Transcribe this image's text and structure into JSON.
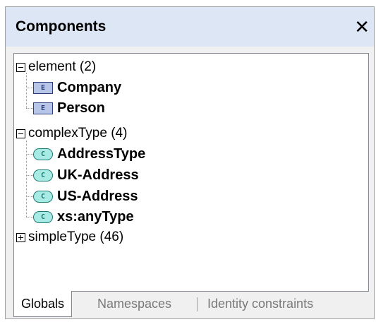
{
  "panel": {
    "title": "Components",
    "close_glyph": "✕"
  },
  "tree": {
    "groups": [
      {
        "label": "element (2)",
        "expanded": true,
        "icon": "collapse-icon",
        "children": [
          {
            "badge": "E",
            "label": "Company",
            "icon": "element-icon"
          },
          {
            "badge": "E",
            "label": "Person",
            "icon": "element-icon"
          }
        ]
      },
      {
        "label": "complexType (4)",
        "expanded": true,
        "icon": "collapse-icon",
        "children": [
          {
            "badge": "C",
            "label": "AddressType",
            "icon": "complex-type-icon"
          },
          {
            "badge": "C",
            "label": "UK-Address",
            "icon": "complex-type-icon"
          },
          {
            "badge": "C",
            "label": "US-Address",
            "icon": "complex-type-icon"
          },
          {
            "badge": "C",
            "label": "xs:anyType",
            "icon": "complex-type-icon"
          }
        ]
      },
      {
        "label": "simpleType (46)",
        "expanded": false,
        "icon": "expand-icon",
        "children": []
      }
    ]
  },
  "tabs": [
    {
      "label": "Globals",
      "active": true
    },
    {
      "label": "Namespaces",
      "active": false
    },
    {
      "label": "Identity constraints",
      "active": false
    }
  ],
  "colors": {
    "header_bg": "#dce6f4",
    "element_badge": "#b6c5e8",
    "complex_badge": "#a8ebe4"
  }
}
